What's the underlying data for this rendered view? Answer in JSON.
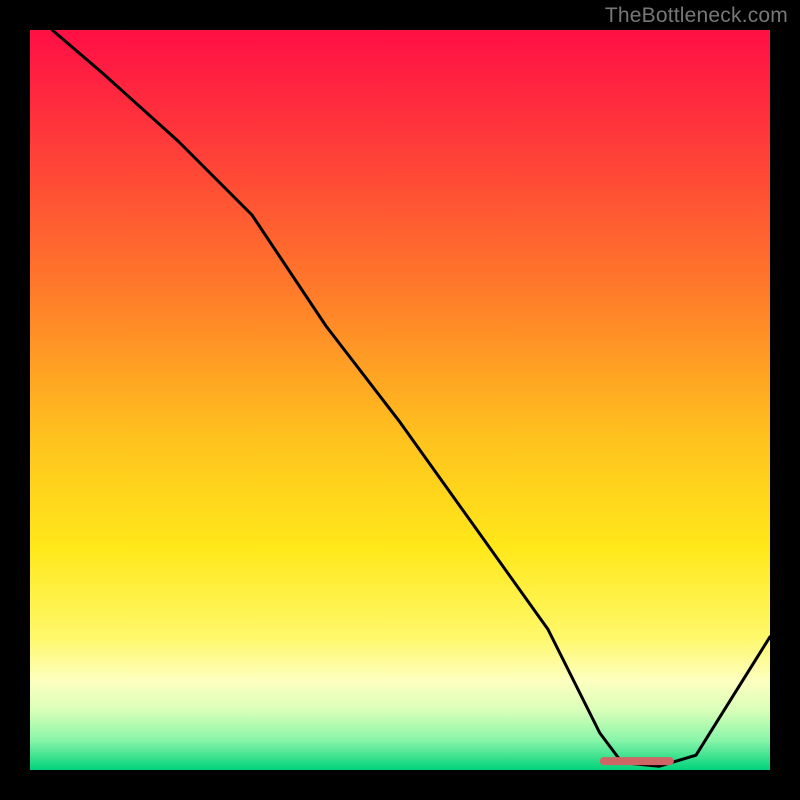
{
  "watermark": "TheBottleneck.com",
  "chart_data": {
    "type": "line",
    "title": "",
    "xlabel": "",
    "ylabel": "",
    "xlim": [
      0,
      100
    ],
    "ylim": [
      0,
      100
    ],
    "x": [
      3,
      10,
      20,
      30,
      40,
      50,
      60,
      70,
      77,
      80,
      85,
      90,
      100
    ],
    "values": [
      100,
      94,
      85,
      75,
      60,
      47,
      33,
      19,
      5,
      1,
      0.5,
      2,
      18
    ],
    "marker": {
      "x_start": 77,
      "x_end": 87,
      "y": 1.2
    },
    "gradient_stops": [
      {
        "offset": 0,
        "color": "#ff0f45"
      },
      {
        "offset": 0.15,
        "color": "#ff3a3a"
      },
      {
        "offset": 0.35,
        "color": "#ff7a2a"
      },
      {
        "offset": 0.55,
        "color": "#ffc21e"
      },
      {
        "offset": 0.7,
        "color": "#ffe81a"
      },
      {
        "offset": 0.82,
        "color": "#fff86a"
      },
      {
        "offset": 0.88,
        "color": "#fdffc0"
      },
      {
        "offset": 0.92,
        "color": "#d8ffb8"
      },
      {
        "offset": 0.96,
        "color": "#88f5a8"
      },
      {
        "offset": 1.0,
        "color": "#00d27a"
      }
    ]
  }
}
